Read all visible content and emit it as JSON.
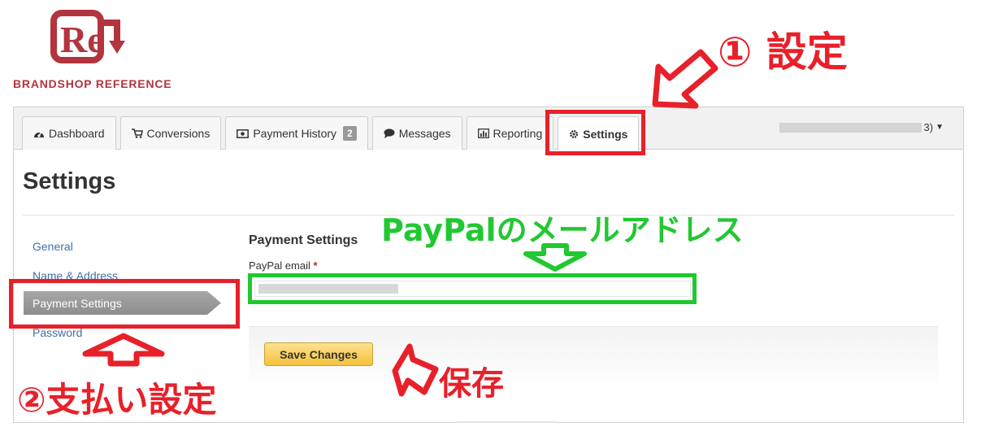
{
  "logo": {
    "mark": "Re",
    "text": "BRANDSHOP REFERENCE"
  },
  "colors": {
    "accent_red": "#e8202a",
    "accent_green": "#21c831",
    "brand": "#b3343e",
    "button": "#f5c23a"
  },
  "tabs": [
    {
      "label": "Dashboard",
      "icon": "dashboard-icon"
    },
    {
      "label": "Conversions",
      "icon": "cart-icon"
    },
    {
      "label": "Payment History",
      "icon": "money-icon",
      "badge": "2"
    },
    {
      "label": "Messages",
      "icon": "chat-bubble-icon"
    },
    {
      "label": "Reporting",
      "icon": "bar-chart-icon"
    },
    {
      "label": "Settings",
      "icon": "gear-icon",
      "active": true
    }
  ],
  "user_menu": {
    "suffix": "3)"
  },
  "page": {
    "title": "Settings"
  },
  "side_nav": [
    {
      "label": "General"
    },
    {
      "label": "Name & Address"
    },
    {
      "label": "Payment Settings",
      "active": true
    },
    {
      "label": "Password"
    }
  ],
  "form": {
    "section_title": "Payment Settings",
    "paypal_label": "PayPal email",
    "required_mark": "*",
    "save_label": "Save Changes"
  },
  "annotations": {
    "step1": "① 設定",
    "step2": "②支払い設定",
    "paypal_note": "PayPalのメールアドレス",
    "save_note": "保存"
  }
}
